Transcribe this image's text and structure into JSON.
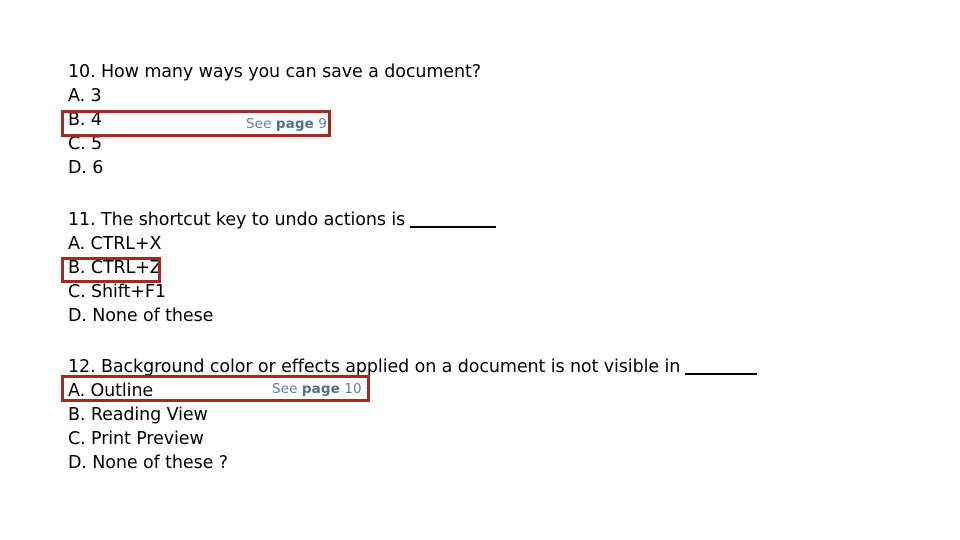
{
  "slide": {
    "background_color": "#FFFFFF",
    "text_color": "#000000",
    "highlight_border_color": "#A32A21",
    "reference_link_color": "#5E8097"
  },
  "questions": [
    {
      "number": "10",
      "stem": "10. How many ways you can save a document?",
      "has_blank": false,
      "options": [
        {
          "label": "A. 3",
          "highlighted": false
        },
        {
          "label": "B. 4",
          "highlighted": true
        },
        {
          "label": "C. 5",
          "highlighted": false
        },
        {
          "label": "D. 6",
          "highlighted": false
        }
      ],
      "reference": {
        "prefix": "See ",
        "strong": "page",
        "suffix": " 9",
        "full": "See page 9"
      }
    },
    {
      "number": "11",
      "stem": "11. The shortcut key to undo actions is ",
      "has_blank": true,
      "options": [
        {
          "label": "A. CTRL+X",
          "highlighted": false
        },
        {
          "label": "B. CTRL+Z",
          "highlighted": true
        },
        {
          "label": "C. Shift+F1",
          "highlighted": false
        },
        {
          "label": "D. None of these",
          "highlighted": false
        }
      ],
      "reference": null
    },
    {
      "number": "12",
      "stem": "12. Background color or effects applied on a document is not visible in ",
      "has_blank": true,
      "options": [
        {
          "label": "A. Outline",
          "highlighted": true
        },
        {
          "label": "B. Reading View",
          "highlighted": false
        },
        {
          "label": "C. Print Preview",
          "highlighted": false
        },
        {
          "label": "D. None of these ?",
          "highlighted": false
        }
      ],
      "reference": {
        "prefix": "See ",
        "strong": "page",
        "suffix": " 10",
        "full": "See page 10"
      }
    }
  ]
}
